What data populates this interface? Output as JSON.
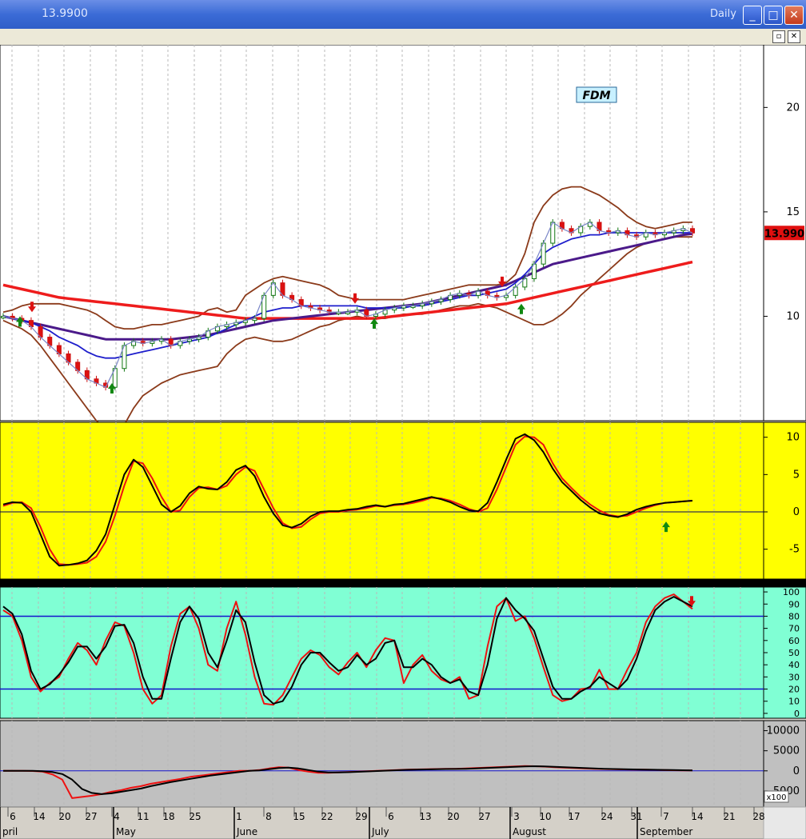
{
  "window": {
    "title": "13.9900",
    "period": "Daily",
    "minimize_glyph": "_",
    "maximize_glyph": "□",
    "close_glyph": "✕",
    "sub_restore_glyph": "▫",
    "sub_close_glyph": "✕"
  },
  "colors": {
    "price_bg": "#ffffff",
    "osc_bg": "#ffff00",
    "stoch_bg": "#80ffd4",
    "vol_bg": "#c0c0c0",
    "bollinger": "#8b3a1a",
    "ma_fast": "#1e1ecc",
    "ma_mid": "#4b1a8a",
    "ma_slow": "#ee1c1c",
    "signal_up": "#118811",
    "signal_down": "#dd1111"
  },
  "x_axis": {
    "day_labels": [
      "6",
      "14",
      "20",
      "27",
      "4",
      "11",
      "18",
      "25",
      "1",
      "8",
      "15",
      "22",
      "29",
      "6",
      "13",
      "20",
      "27",
      "3",
      "10",
      "17",
      "24",
      "31",
      "7",
      "14",
      "21",
      "28"
    ],
    "month_labels": [
      "pril",
      "May",
      "June",
      "July",
      "August",
      "September"
    ]
  },
  "chart_data": [
    {
      "type": "candlestick",
      "title": "FDM",
      "yticks": [
        10,
        15,
        20
      ],
      "ylim": [
        5,
        23
      ],
      "last_price_label": "13.990",
      "series": [
        {
          "name": "close",
          "values": [
            10,
            9.9,
            9.8,
            9.5,
            9.0,
            8.6,
            8.2,
            7.8,
            7.4,
            7.0,
            6.8,
            6.6,
            7.5,
            8.6,
            8.8,
            8.7,
            8.8,
            8.9,
            8.6,
            8.8,
            8.9,
            9.0,
            9.3,
            9.5,
            9.6,
            9.7,
            9.8,
            9.9,
            11.0,
            11.6,
            11.0,
            10.8,
            10.5,
            10.4,
            10.3,
            10.2,
            10.2,
            10.2,
            10.3,
            10.0,
            10.1,
            10.3,
            10.4,
            10.5,
            10.5,
            10.6,
            10.7,
            10.8,
            11.0,
            11.1,
            11.0,
            11.2,
            11.0,
            10.9,
            11.0,
            11.4,
            11.8,
            12.5,
            13.5,
            14.5,
            14.2,
            14.0,
            14.3,
            14.5,
            14.1,
            14.0,
            14.1,
            13.9,
            13.8,
            14.0,
            13.9,
            14.0,
            14.1,
            14.2,
            13.99
          ]
        },
        {
          "name": "fast_ma",
          "values": [
            10,
            9.9,
            9.8,
            9.7,
            9.5,
            9.3,
            9.0,
            8.8,
            8.6,
            8.3,
            8.1,
            8.0,
            8.0,
            8.1,
            8.2,
            8.3,
            8.4,
            8.5,
            8.6,
            8.7,
            8.8,
            8.9,
            9.0,
            9.2,
            9.4,
            9.6,
            9.8,
            10.0,
            10.2,
            10.3,
            10.4,
            10.4,
            10.5,
            10.5,
            10.5,
            10.5,
            10.5,
            10.5,
            10.5,
            10.4,
            10.4,
            10.4,
            10.4,
            10.4,
            10.5,
            10.5,
            10.6,
            10.7,
            10.8,
            10.9,
            11.0,
            11.0,
            11.1,
            11.2,
            11.3,
            11.6,
            12.0,
            12.5,
            13.0,
            13.3,
            13.5,
            13.7,
            13.8,
            13.9,
            13.9,
            14.0,
            14.0,
            14.0,
            14.0,
            14.0,
            14.0,
            14.0,
            14.0,
            14.0,
            14.0
          ]
        },
        {
          "name": "mid_ma",
          "values": [
            10,
            9.9,
            9.8,
            9.7,
            9.6,
            9.5,
            9.4,
            9.3,
            9.2,
            9.1,
            9.0,
            8.9,
            8.9,
            8.9,
            8.9,
            8.9,
            8.9,
            8.9,
            8.9,
            8.95,
            9.0,
            9.05,
            9.1,
            9.2,
            9.3,
            9.4,
            9.5,
            9.6,
            9.7,
            9.8,
            9.85,
            9.9,
            9.95,
            10.0,
            10.05,
            10.1,
            10.15,
            10.2,
            10.25,
            10.3,
            10.35,
            10.4,
            10.45,
            10.5,
            10.55,
            10.6,
            10.7,
            10.8,
            10.9,
            11.0,
            11.1,
            11.2,
            11.3,
            11.4,
            11.5,
            11.7,
            11.9,
            12.1,
            12.3,
            12.5,
            12.6,
            12.7,
            12.8,
            12.9,
            13.0,
            13.1,
            13.2,
            13.3,
            13.4,
            13.5,
            13.6,
            13.7,
            13.8,
            13.9,
            13.95
          ]
        },
        {
          "name": "slow_ma",
          "values": [
            11.5,
            11.4,
            11.3,
            11.2,
            11.1,
            11.0,
            10.9,
            10.85,
            10.8,
            10.75,
            10.7,
            10.65,
            10.6,
            10.55,
            10.5,
            10.45,
            10.4,
            10.35,
            10.3,
            10.25,
            10.2,
            10.15,
            10.1,
            10.05,
            10.0,
            9.95,
            9.9,
            9.9,
            9.9,
            9.9,
            9.9,
            9.9,
            9.9,
            9.9,
            9.9,
            9.9,
            9.9,
            9.9,
            9.9,
            9.9,
            9.9,
            9.95,
            10.0,
            10.05,
            10.1,
            10.15,
            10.2,
            10.25,
            10.3,
            10.35,
            10.4,
            10.45,
            10.5,
            10.55,
            10.6,
            10.7,
            10.8,
            10.9,
            11.0,
            11.1,
            11.2,
            11.3,
            11.4,
            11.5,
            11.6,
            11.7,
            11.8,
            11.9,
            12.0,
            12.1,
            12.2,
            12.3,
            12.4,
            12.5,
            12.6
          ]
        },
        {
          "name": "bb_upper",
          "values": [
            10.2,
            10.3,
            10.5,
            10.6,
            10.6,
            10.6,
            10.6,
            10.5,
            10.4,
            10.3,
            10.1,
            9.8,
            9.5,
            9.4,
            9.4,
            9.5,
            9.6,
            9.6,
            9.7,
            9.8,
            9.9,
            10.0,
            10.3,
            10.4,
            10.2,
            10.3,
            11.0,
            11.3,
            11.6,
            11.8,
            11.9,
            11.8,
            11.7,
            11.6,
            11.5,
            11.3,
            11.0,
            10.9,
            10.8,
            10.8,
            10.8,
            10.8,
            10.8,
            10.8,
            10.9,
            11.0,
            11.1,
            11.2,
            11.3,
            11.4,
            11.5,
            11.5,
            11.5,
            11.5,
            11.6,
            12.0,
            13.0,
            14.5,
            15.3,
            15.8,
            16.1,
            16.2,
            16.2,
            16.0,
            15.8,
            15.5,
            15.2,
            14.8,
            14.5,
            14.3,
            14.2,
            14.3,
            14.4,
            14.5,
            14.5
          ]
        },
        {
          "name": "bb_lower",
          "values": [
            9.8,
            9.6,
            9.4,
            9.1,
            8.6,
            8.0,
            7.4,
            6.8,
            6.2,
            5.6,
            5.0,
            4.6,
            4.4,
            4.8,
            5.6,
            6.2,
            6.5,
            6.8,
            7.0,
            7.2,
            7.3,
            7.4,
            7.5,
            7.6,
            8.2,
            8.6,
            8.9,
            9.0,
            8.9,
            8.8,
            8.8,
            8.9,
            9.1,
            9.3,
            9.5,
            9.6,
            9.8,
            9.9,
            10.0,
            9.9,
            9.9,
            9.9,
            10.0,
            10.1,
            10.1,
            10.1,
            10.2,
            10.3,
            10.4,
            10.5,
            10.5,
            10.6,
            10.5,
            10.4,
            10.2,
            10.0,
            9.8,
            9.6,
            9.6,
            9.8,
            10.1,
            10.5,
            11.0,
            11.4,
            11.8,
            12.2,
            12.6,
            13.0,
            13.3,
            13.5,
            13.6,
            13.7,
            13.8,
            13.8,
            13.8
          ]
        }
      ]
    },
    {
      "type": "line",
      "yticks": [
        10,
        5,
        0,
        -5
      ],
      "ylim": [
        -9,
        12
      ],
      "series": [
        {
          "name": "signal",
          "values": [
            0.8,
            1.2,
            1.3,
            0.5,
            -2.0,
            -5.0,
            -7.0,
            -7.1,
            -7.0,
            -6.8,
            -6.0,
            -4.0,
            -0.5,
            3.5,
            6.8,
            6.5,
            4.5,
            2.0,
            0.0,
            0.2,
            2.0,
            3.2,
            3.3,
            3.0,
            3.5,
            5.0,
            6.0,
            5.5,
            3.0,
            0.5,
            -1.5,
            -2.2,
            -2.0,
            -1.0,
            -0.2,
            0.0,
            0.0,
            0.2,
            0.3,
            0.5,
            0.8,
            0.7,
            0.9,
            1.0,
            1.2,
            1.5,
            1.9,
            1.8,
            1.5,
            1.0,
            0.4,
            0.0,
            0.5,
            3.0,
            6.0,
            9.0,
            10.1,
            10.0,
            9.0,
            6.5,
            4.5,
            3.2,
            2.0,
            1.0,
            0.2,
            -0.4,
            -0.6,
            -0.5,
            0.0,
            0.5,
            0.9,
            1.2,
            1.3,
            1.4,
            1.5
          ]
        },
        {
          "name": "oscillator",
          "values": [
            1.0,
            1.3,
            1.2,
            0.0,
            -3.0,
            -6.0,
            -7.2,
            -7.1,
            -6.9,
            -6.5,
            -5.2,
            -3.0,
            1.0,
            5.0,
            7.0,
            6.0,
            3.5,
            1.0,
            0.0,
            0.8,
            2.5,
            3.4,
            3.1,
            3.0,
            4.0,
            5.6,
            6.2,
            4.8,
            2.0,
            -0.2,
            -1.8,
            -2.1,
            -1.6,
            -0.6,
            0.0,
            0.1,
            0.1,
            0.3,
            0.4,
            0.7,
            0.9,
            0.7,
            1.0,
            1.1,
            1.4,
            1.7,
            2.0,
            1.7,
            1.3,
            0.7,
            0.2,
            0.1,
            1.2,
            4.0,
            7.0,
            9.8,
            10.4,
            9.6,
            8.0,
            5.8,
            4.0,
            2.8,
            1.6,
            0.6,
            -0.2,
            -0.5,
            -0.7,
            -0.3,
            0.3,
            0.7,
            1.0,
            1.2,
            1.3,
            1.4,
            1.5
          ]
        }
      ]
    },
    {
      "type": "line",
      "yticks": [
        100,
        90,
        80,
        70,
        60,
        50,
        40,
        30,
        20,
        10,
        0
      ],
      "ylim": [
        -4,
        104
      ],
      "reference_lines": [
        80,
        20
      ],
      "series": [
        {
          "name": "fast",
          "values": [
            85,
            80,
            60,
            30,
            18,
            25,
            30,
            45,
            58,
            52,
            40,
            60,
            75,
            72,
            50,
            20,
            8,
            15,
            55,
            82,
            88,
            70,
            40,
            35,
            70,
            92,
            65,
            30,
            8,
            7,
            15,
            30,
            45,
            52,
            48,
            38,
            32,
            42,
            50,
            38,
            52,
            62,
            60,
            25,
            40,
            48,
            35,
            28,
            25,
            30,
            12,
            15,
            55,
            88,
            95,
            76,
            80,
            62,
            38,
            15,
            10,
            12,
            20,
            21,
            36,
            20,
            20,
            36,
            50,
            75,
            88,
            95,
            98,
            92,
            86
          ]
        },
        {
          "name": "slow",
          "values": [
            88,
            82,
            65,
            35,
            20,
            24,
            32,
            42,
            55,
            55,
            45,
            55,
            72,
            73,
            58,
            30,
            12,
            12,
            45,
            75,
            88,
            78,
            50,
            38,
            60,
            85,
            75,
            42,
            15,
            8,
            10,
            22,
            40,
            50,
            50,
            42,
            35,
            38,
            48,
            40,
            45,
            58,
            60,
            38,
            38,
            45,
            40,
            30,
            25,
            28,
            18,
            15,
            40,
            78,
            95,
            85,
            78,
            68,
            45,
            22,
            12,
            12,
            18,
            22,
            30,
            25,
            20,
            28,
            45,
            68,
            85,
            92,
            96,
            92,
            88
          ]
        }
      ]
    },
    {
      "type": "line",
      "yticks": [
        10000,
        5000,
        0,
        -5000
      ],
      "ylim": [
        -9000,
        12500
      ],
      "scale_label": "x100",
      "series": [
        {
          "name": "fast",
          "values": [
            0,
            0,
            0,
            -50,
            -200,
            -900,
            -2200,
            -6800,
            -6500,
            -6200,
            -5800,
            -5200,
            -4800,
            -4200,
            -3800,
            -3200,
            -2800,
            -2400,
            -2000,
            -1500,
            -1200,
            -900,
            -600,
            -300,
            0,
            0,
            200,
            600,
            900,
            800,
            200,
            -200,
            -500,
            -500,
            -400,
            -300,
            -200,
            -100,
            0,
            100,
            200,
            300,
            350,
            400,
            450,
            500,
            500,
            600,
            700,
            800,
            900,
            1000,
            1100,
            1200,
            1150,
            1050,
            900,
            800,
            700,
            600,
            500,
            450,
            400,
            350,
            300,
            300,
            250,
            200,
            150,
            100,
            100
          ]
        },
        {
          "name": "slow",
          "values": [
            0,
            0,
            0,
            0,
            -100,
            -300,
            -800,
            -2200,
            -4500,
            -5500,
            -5800,
            -5600,
            -5200,
            -4800,
            -4400,
            -3800,
            -3300,
            -2800,
            -2400,
            -2000,
            -1600,
            -1200,
            -900,
            -600,
            -300,
            0,
            100,
            400,
            700,
            800,
            600,
            200,
            -200,
            -400,
            -400,
            -350,
            -250,
            -150,
            -50,
            50,
            150,
            250,
            300,
            350,
            400,
            450,
            480,
            520,
            600,
            700,
            800,
            900,
            1000,
            1100,
            1150,
            1100,
            1000,
            900,
            800,
            700,
            600,
            520,
            460,
            400,
            350,
            320,
            280,
            240,
            200,
            150,
            120
          ]
        }
      ]
    }
  ]
}
